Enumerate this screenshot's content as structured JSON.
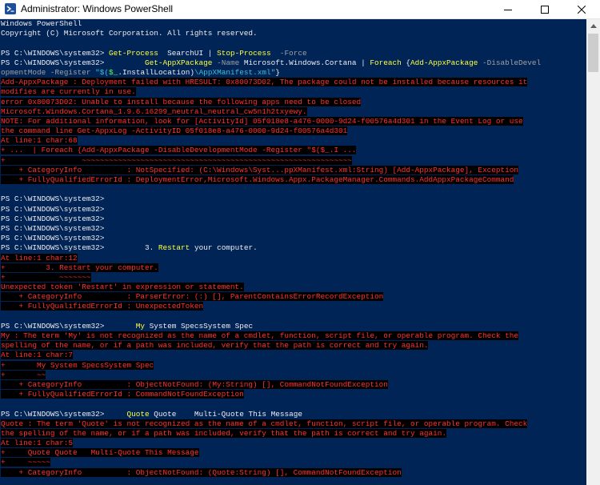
{
  "window": {
    "title": "Administrator: Windows PowerShell"
  },
  "icons": {
    "app": "powershell-icon",
    "minimize": "minimize-icon",
    "maximize": "maximize-icon",
    "close": "close-icon",
    "scroll_up": "chevron-up-icon"
  },
  "colors": {
    "console_bg": "#012456",
    "error_text": "#ff3030",
    "error_bg": "#000000",
    "cmdlet": "#ffff40",
    "parameter": "#a0a0a0",
    "string": "#3bc0d6",
    "variable": "#58ff58"
  },
  "console": {
    "header1": "Windows PowerShell",
    "header2": "Copyright (C) Microsoft Corporation. All rights reserved.",
    "lines": {
      "l1": {
        "prompt": "PS C:\\WINDOWS\\system32>",
        "a": " Get-Process",
        "b": "  SearchUI | ",
        "c": "Stop-Process",
        "d": "  -Force"
      },
      "l2": {
        "prompt": "PS C:\\WINDOWS\\system32>",
        "a": "         Get-AppXPackage",
        "b": " -Name ",
        "c": "Microsoft.Windows.Cortana | ",
        "d": "Foreach",
        "e": " {",
        "f": "Add-AppxPackage",
        "g": " -DisableDevel"
      },
      "l3": {
        "a": "opmentMode -Register ",
        "b": "\"$(",
        "c": "$_",
        "d": ".InstallLocation)",
        "e": "\\AppXManifest.xml\"",
        "f": "}"
      },
      "e1": "Add-AppxPackage : Deployment failed with HRESULT: 0x80073D02, The package could not be installed because resources it",
      "e2": "modifies are currently in use.",
      "e3": "error 0x80073D02: Unable to install because the following apps need to be closed",
      "e4": "Microsoft.Windows.Cortana_1.9.6.16299_neutral_neutral_cw5n1h2txyewy.",
      "e5": "NOTE: For additional information, look for [ActivityId] 05f018e8-a476-0000-9d24-f00576a4d301 in the Event Log or use",
      "e6": "the command line Get-AppxLog -ActivityID 05f018e8-a476-0000-9d24-f00576a4d301",
      "e7": "At line:1 char:68",
      "e8": "+ ...  | Foreach {Add-AppxPackage -DisableDevelopmentMode -Register \"$($_.I ...",
      "e9": "+                 ~~~~~~~~~~~~~~~~~~~~~~~~~~~~~~~~~~~~~~~~~~~~~~~~~~~~~~~~~~~~",
      "e10": "    + CategoryInfo          : NotSpecified: (C:\\Windows\\Syst...ppXManifest.xml:String) [Add-AppxPackage], Exception",
      "e11": "    + FullyQualifiedErrorId : DeploymentError,Microsoft.Windows.Appx.PackageManager.Commands.AddAppxPackageCommand",
      "p1": "PS C:\\WINDOWS\\system32>",
      "p2": "PS C:\\WINDOWS\\system32>",
      "p3": "PS C:\\WINDOWS\\system32>",
      "p4": "PS C:\\WINDOWS\\system32>",
      "p5": "PS C:\\WINDOWS\\system32>",
      "l4": {
        "prompt": "PS C:\\WINDOWS\\system32>",
        "a": "         3. ",
        "b": "Restart",
        "c": " your computer."
      },
      "f1": "At line:1 char:12",
      "f2": "+         3. Restart your computer.",
      "f3": "+            ~~~~~~~",
      "f4": "Unexpected token 'Restart' in expression or statement.",
      "f5": "    + CategoryInfo          : ParserError: (:) [], ParentContainsErrorRecordException",
      "f6": "    + FullyQualifiedErrorId : UnexpectedToken",
      "l5": {
        "prompt": "PS C:\\WINDOWS\\system32>",
        "a": "       My",
        "b": " System SpecsSystem Spec"
      },
      "g1": "My : The term 'My' is not recognized as the name of a cmdlet, function, script file, or operable program. Check the",
      "g2": "spelling of the name, or if a path was included, verify that the path is correct and try again.",
      "g3": "At line:1 char:7",
      "g4": "+       My System SpecsSystem Spec",
      "g5": "+       ~~",
      "g6": "    + CategoryInfo          : ObjectNotFound: (My:String) [], CommandNotFoundException",
      "g7": "    + FullyQualifiedErrorId : CommandNotFoundException",
      "l6": {
        "prompt": "PS C:\\WINDOWS\\system32>",
        "a": "     Quote",
        "b": " Quote    Multi-Quote This Message"
      },
      "h1": "Quote : The term 'Quote' is not recognized as the name of a cmdlet, function, script file, or operable program. Check",
      "h2": "the spelling of the name, or if a path was included, verify that the path is correct and try again.",
      "h3": "At line:1 char:5",
      "h4": "+     Quote Quote   Multi-Quote This Message",
      "h5": "+     ~~~~~",
      "h6": "    + CategoryInfo          : ObjectNotFound: (Quote:String) [], CommandNotFoundException"
    }
  }
}
